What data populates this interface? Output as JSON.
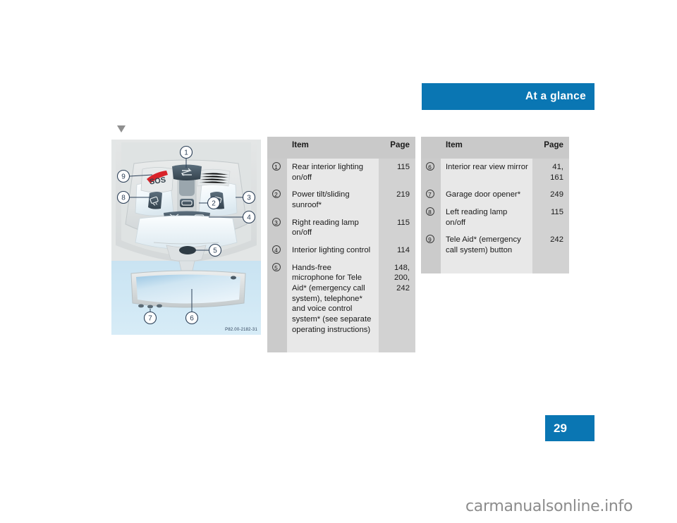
{
  "header": {
    "title": "At a glance"
  },
  "page_number": "29",
  "illustration": {
    "code": "P82.00-2182-31",
    "callouts": [
      "1",
      "2",
      "3",
      "4",
      "5",
      "6",
      "7",
      "8",
      "9"
    ],
    "sos_label": "SOS"
  },
  "tables": [
    {
      "name": "overhead-control-panel-table",
      "columns": [
        "Item",
        "Page"
      ],
      "rows": [
        {
          "num": "1",
          "item": "Rear interior lighting on/off",
          "page": "115"
        },
        {
          "num": "2",
          "item": "Power tilt/sliding sunroof*",
          "page": "219"
        },
        {
          "num": "3",
          "item": "Right reading lamp on/off",
          "page": "115"
        },
        {
          "num": "4",
          "item": "Interior lighting control",
          "page": "114"
        },
        {
          "num": "5",
          "item": "Hands-free microphone for Tele Aid* (emergency call system), telephone* and voice control system* (see separate operating instructions)",
          "page": "148,\n200,\n242"
        }
      ]
    },
    {
      "name": "mirror-and-buttons-table",
      "columns": [
        "Item",
        "Page"
      ],
      "rows": [
        {
          "num": "6",
          "item": "Interior rear view mirror",
          "page": "41,\n161"
        },
        {
          "num": "7",
          "item": "Garage door opener*",
          "page": "249"
        },
        {
          "num": "8",
          "item": "Left reading lamp on/off",
          "page": "115"
        },
        {
          "num": "9",
          "item": "Tele Aid* (emergency call system) button",
          "page": "242"
        }
      ]
    }
  ],
  "watermark": "carmanualsonline.info",
  "colors": {
    "accent_blue": "#0a76b3",
    "table_header_gray": "#c9c9c9",
    "table_item_gray": "#e8e8e8",
    "table_page_gray": "#d2d2d2",
    "marker_gray": "#8f8f8f"
  }
}
